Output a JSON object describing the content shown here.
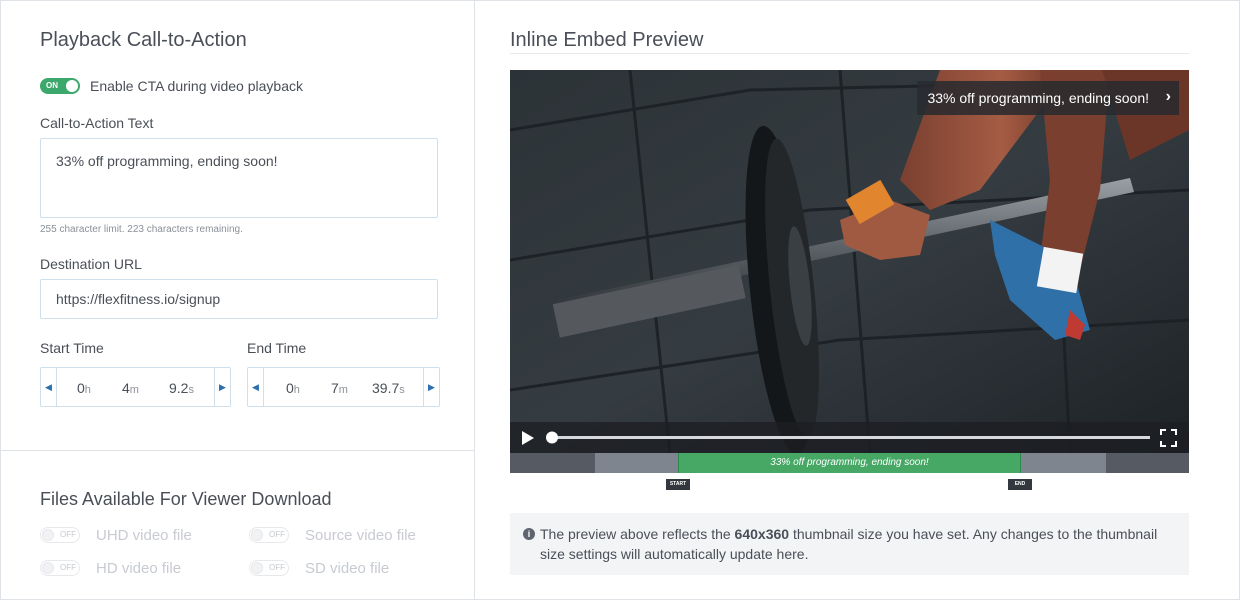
{
  "left": {
    "cta_title": "Playback Call-to-Action",
    "enable_toggle": {
      "state_label": "ON",
      "label": "Enable CTA during video playback"
    },
    "cta_text_label": "Call-to-Action Text",
    "cta_text_value": "33% off programming, ending soon!",
    "cta_hint": "255 character limit. 223 characters remaining.",
    "url_label": "Destination URL",
    "url_value": "https://flexfitness.io/signup",
    "start_time": {
      "label": "Start Time",
      "h": "0",
      "m": "4",
      "s": "9.2",
      "unit_h": "h",
      "unit_m": "m",
      "unit_s": "s"
    },
    "end_time": {
      "label": "End Time",
      "h": "0",
      "m": "7",
      "s": "39.7",
      "unit_h": "h",
      "unit_m": "m",
      "unit_s": "s"
    },
    "downloads_title": "Files Available For Viewer Download",
    "downloads": [
      {
        "state_label": "OFF",
        "label": "UHD video file"
      },
      {
        "state_label": "OFF",
        "label": "Source video file"
      },
      {
        "state_label": "OFF",
        "label": "HD video file"
      },
      {
        "state_label": "OFF",
        "label": "SD video file"
      }
    ]
  },
  "right": {
    "preview_title": "Inline Embed Preview",
    "cta_overlay": "33% off programming, ending soon!",
    "timeline_label": "33% off programming, ending soon!",
    "start_marker": "START",
    "end_marker": "END",
    "playback_progress": 0.0,
    "info": {
      "text_before": "The preview above reflects the ",
      "size": "640x360",
      "text_after": " thumbnail size you have set. Any changes to the thumbnail size settings will automatically update here."
    }
  },
  "colors": {
    "accent_green": "#3da86b",
    "link_blue": "#2b6fb0"
  },
  "icons": [
    "play-icon",
    "fullscreen-icon",
    "chevron-right-icon",
    "info-icon",
    "chevron-left-icon"
  ]
}
